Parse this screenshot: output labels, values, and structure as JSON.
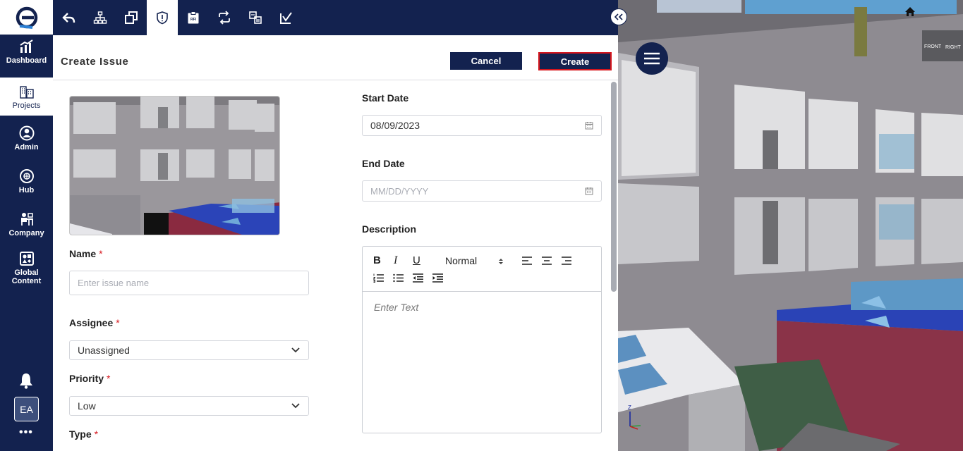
{
  "nav": {
    "items": [
      {
        "label": "Dashboard"
      },
      {
        "label": "Projects"
      },
      {
        "label": "Admin"
      },
      {
        "label": "Hub"
      },
      {
        "label": "Company"
      },
      {
        "label": "Global Content"
      }
    ],
    "avatar": "EA",
    "more": "•••"
  },
  "toolbar": {
    "icons": [
      "back-icon",
      "hierarchy-icon",
      "windows-icon",
      "issue-icon",
      "rfi-icon",
      "sync-icon",
      "compare-icon",
      "markup-icon"
    ],
    "active": "issue-icon"
  },
  "header": {
    "title": "Create Issue",
    "cancel_label": "Cancel",
    "create_label": "Create"
  },
  "form": {
    "name": {
      "label": "Name",
      "required": "*",
      "placeholder": "Enter issue name"
    },
    "assignee": {
      "label": "Assignee",
      "required": "*",
      "value": "Unassigned"
    },
    "priority": {
      "label": "Priority",
      "required": "*",
      "value": "Low"
    },
    "type": {
      "label": "Type",
      "required": "*"
    },
    "start_date": {
      "label": "Start Date",
      "value": "08/09/2023"
    },
    "end_date": {
      "label": "End Date",
      "placeholder": "MM/DD/YYYY"
    },
    "description": {
      "label": "Description",
      "format": "Normal",
      "placeholder": "Enter Text",
      "bold": "B",
      "italic": "I",
      "underline": "U"
    }
  },
  "viewport": {
    "viewcube_front": "FRONT",
    "viewcube_right": "RIGHT",
    "axis_z": "Z"
  },
  "colors": {
    "navy": "#13224f",
    "required": "#d6161d"
  }
}
